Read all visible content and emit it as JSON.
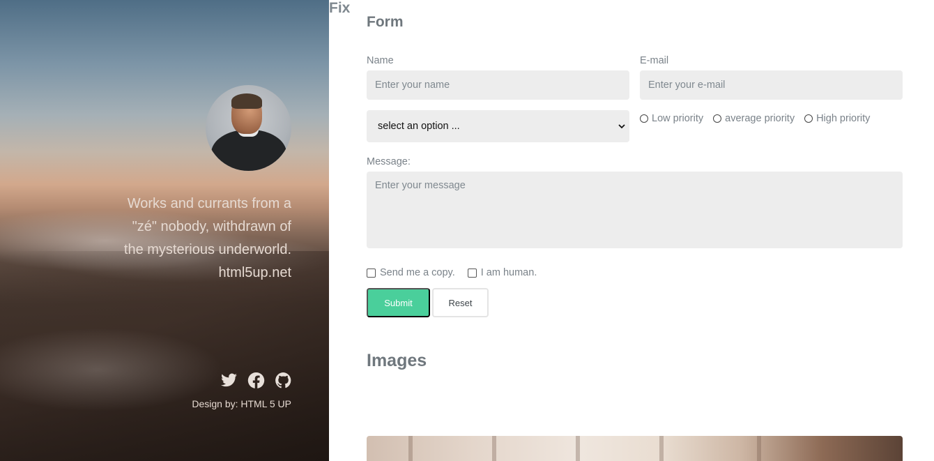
{
  "sidebar": {
    "tagline": [
      "Works and currants from a",
      "\"zé\" nobody, withdrawn of",
      "the mysterious underworld.",
      "html5up.net"
    ],
    "socials": [
      {
        "icon": "twitter-icon",
        "label": "Twitter"
      },
      {
        "icon": "facebook-icon",
        "label": "Facebook"
      },
      {
        "icon": "github-icon",
        "label": "GitHub"
      }
    ],
    "credit": "Design by: HTML 5 UP"
  },
  "form": {
    "heading": "Form",
    "name_label": "Name",
    "name_placeholder": "Enter your name",
    "email_label": "E-mail",
    "email_placeholder": "Enter your e-mail",
    "select_value": "select an option ...",
    "priorities": [
      "Low priority",
      "average priority",
      "High priority"
    ],
    "message_label": "Message:",
    "message_placeholder": "Enter your message",
    "checkboxes": [
      "Send me a copy.",
      "I am human."
    ],
    "submit_label": "Submit",
    "reset_label": "Reset"
  },
  "images": {
    "heading": "Images",
    "fix_heading": "Fix"
  },
  "colors": {
    "accent": "#4acf9b",
    "heading": "#6f777d",
    "text": "#7f888f",
    "field_bg": "#ededed"
  }
}
